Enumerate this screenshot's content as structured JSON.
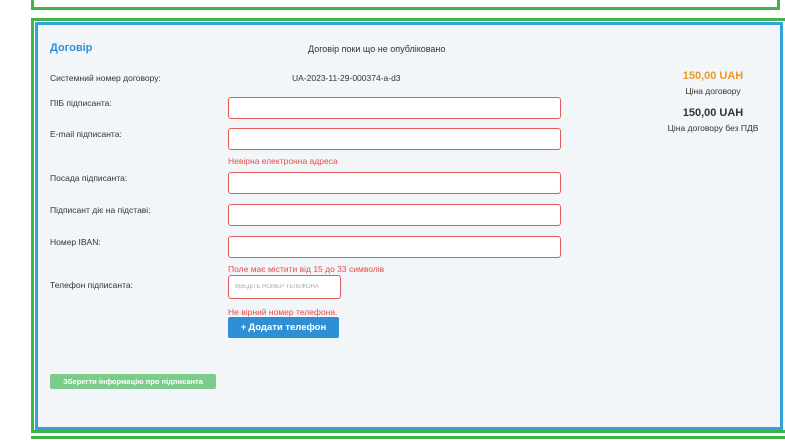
{
  "contract": {
    "title": "Договір",
    "status": "Договір поки що не опубліковано",
    "system_number_label": "Системний номер договору:",
    "system_number_value": "UA-2023-11-29-000374-a-d3"
  },
  "fields": {
    "name_label": "ПІБ підписанта:",
    "email_label": "E-mail підписанта:",
    "email_error": "Невірна електронна адреса",
    "position_label": "Посада підписанта:",
    "basis_label": "Підписант діє на підставі:",
    "iban_label": "Номер IBAN:",
    "iban_error": "Поле має містити від 15 до 33 символів",
    "phone_label": "Телефон підписанта:",
    "phone_placeholder": "Введіть номер телефона",
    "phone_error": "Не вірний номер телефона."
  },
  "buttons": {
    "add_phone_icon": "+",
    "add_phone": "Додати телефон",
    "save": "Зберегти інформацію про підписанта"
  },
  "prices": {
    "price": "150,00 UAH",
    "price_caption": "Ціна договору",
    "price_no_vat": "150,00 UAH",
    "price_no_vat_caption": "Ціна договору без ПДВ"
  },
  "colors": {
    "frame_green": "#3fb44a",
    "panel_blue": "#33a3de",
    "error_red": "#e04c4c",
    "price_orange": "#f0962a",
    "save_green": "#7ccb8a"
  }
}
